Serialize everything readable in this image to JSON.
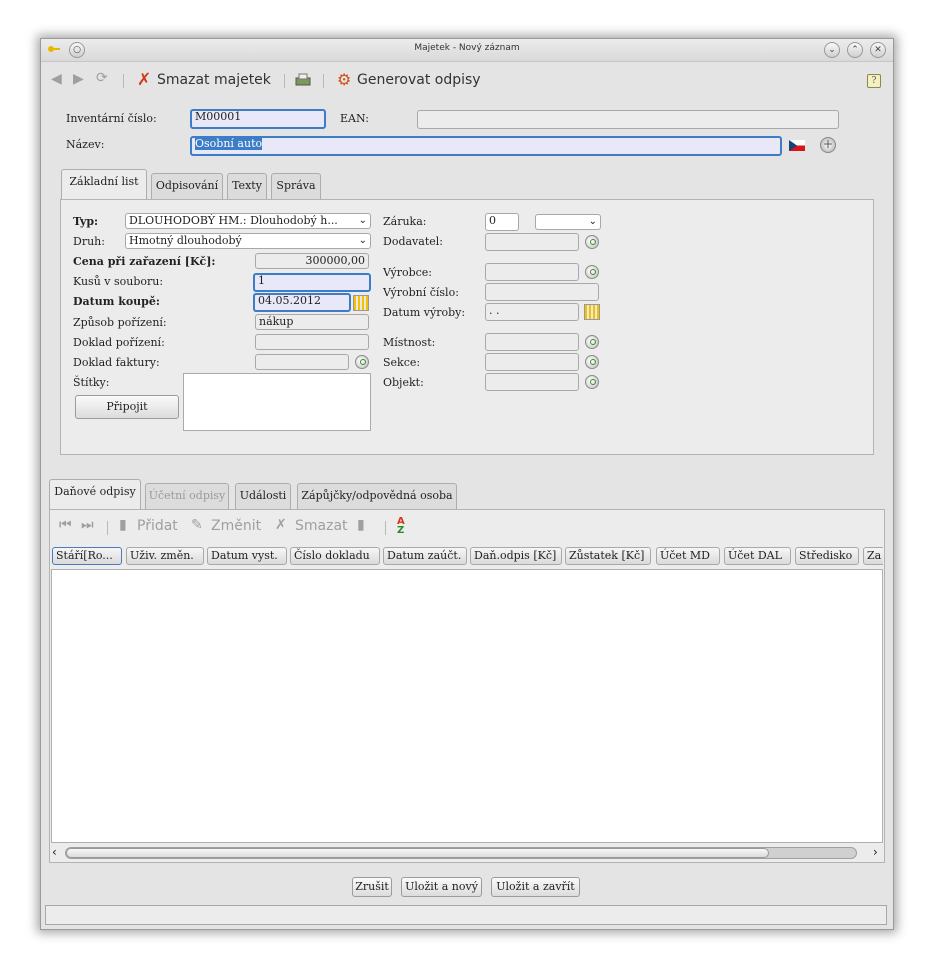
{
  "window": {
    "title": "Majetek - Nový záznam"
  },
  "toolbar": {
    "delete_label": "Smazat majetek",
    "generate_label": "Generovat odpisy"
  },
  "header": {
    "inv_label": "Inventární číslo:",
    "inv_value": "M00001",
    "ean_label": "EAN:",
    "ean_value": "",
    "name_label": "Název:",
    "name_value": "Osobní auto"
  },
  "tabs": [
    "Základní list",
    "Odpisování",
    "Texty",
    "Správa"
  ],
  "basic": {
    "typ_label": "Typ:",
    "typ_value": "DLOUHODOBÝ HM.: Dlouhodobý h...",
    "druh_label": "Druh:",
    "druh_value": "Hmotný dlouhodobý",
    "cena_label": "Cena při zařazení [Kč]:",
    "cena_value": "300000,00",
    "kusu_label": "Kusů v souboru:",
    "kusu_value": "1",
    "datum_label": "Datum koupě:",
    "datum_value": "04.05.2012",
    "zpusob_label": "Způsob pořízení:",
    "zpusob_value": "nákup",
    "doklad_por_label": "Doklad pořízení:",
    "doklad_fakt_label": "Doklad faktury:",
    "stitky_label": "Štítky:",
    "pripojit_label": "Připojit",
    "zaruka_label": "Záruka:",
    "zaruka_value": "0",
    "dodavatel_label": "Dodavatel:",
    "vyrobce_label": "Výrobce:",
    "vyrobni_cislo_label": "Výrobní číslo:",
    "datum_vyroby_label": "Datum výroby:",
    "datum_vyroby_value": " .  .",
    "mistnost_label": "Místnost:",
    "sekce_label": "Sekce:",
    "objekt_label": "Objekt:"
  },
  "lower_tabs": [
    "Daňové odpisy",
    "Účetní odpisy",
    "Události",
    "Zápůjčky/odpovědná osoba"
  ],
  "lower_toolbar": {
    "pridat": "Přidat",
    "zmenit": "Změnit",
    "smazat": "Smazat"
  },
  "table": {
    "columns": [
      "Stáří[Ro...",
      "Uživ. změn.",
      "Datum vyst.",
      "Číslo dokladu",
      "Datum zaúčt.",
      "Daň.odpis [Kč]",
      "Zůstatek [Kč]",
      "Účet MD",
      "Účet DAL",
      "Středisko",
      "Za"
    ]
  },
  "footer": {
    "zrusit": "Zrušit",
    "ulozit_novy": "Uložit a nový",
    "ulozit_zavrit": "Uložit a zavřít"
  }
}
